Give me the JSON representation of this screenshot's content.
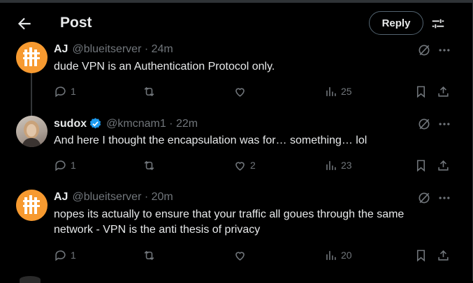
{
  "header": {
    "title": "Post",
    "reply_label": "Reply"
  },
  "tweets": [
    {
      "name": "AJ",
      "handle": "@blueitserver · 24m",
      "verified": false,
      "text": "dude VPN is an Authentication Protocol only.",
      "reply_count": "1",
      "repost_count": "",
      "like_count": "",
      "views": "25"
    },
    {
      "name": "sudox",
      "handle": "@kmcnam1 · 22m",
      "verified": true,
      "text": "And here I thought the encapsulation was for… something… lol",
      "reply_count": "1",
      "repost_count": "",
      "like_count": "2",
      "views": "23"
    },
    {
      "name": "AJ",
      "handle": "@blueitserver · 20m",
      "verified": false,
      "text": "nopes its actually to ensure that your traffic all goues through the same network - VPN is the anti thesis of privacy",
      "reply_count": "1",
      "repost_count": "",
      "like_count": "",
      "views": "20"
    }
  ],
  "colors": {
    "accent": "#1d9bf0",
    "muted": "#71767b",
    "avatar_aj": "#f79a30"
  },
  "icons": [
    "back-arrow-icon",
    "filter-icon",
    "grok-icon",
    "more-icon",
    "reply-icon",
    "repost-icon",
    "like-icon",
    "views-icon",
    "bookmark-icon",
    "share-icon",
    "verified-icon"
  ]
}
